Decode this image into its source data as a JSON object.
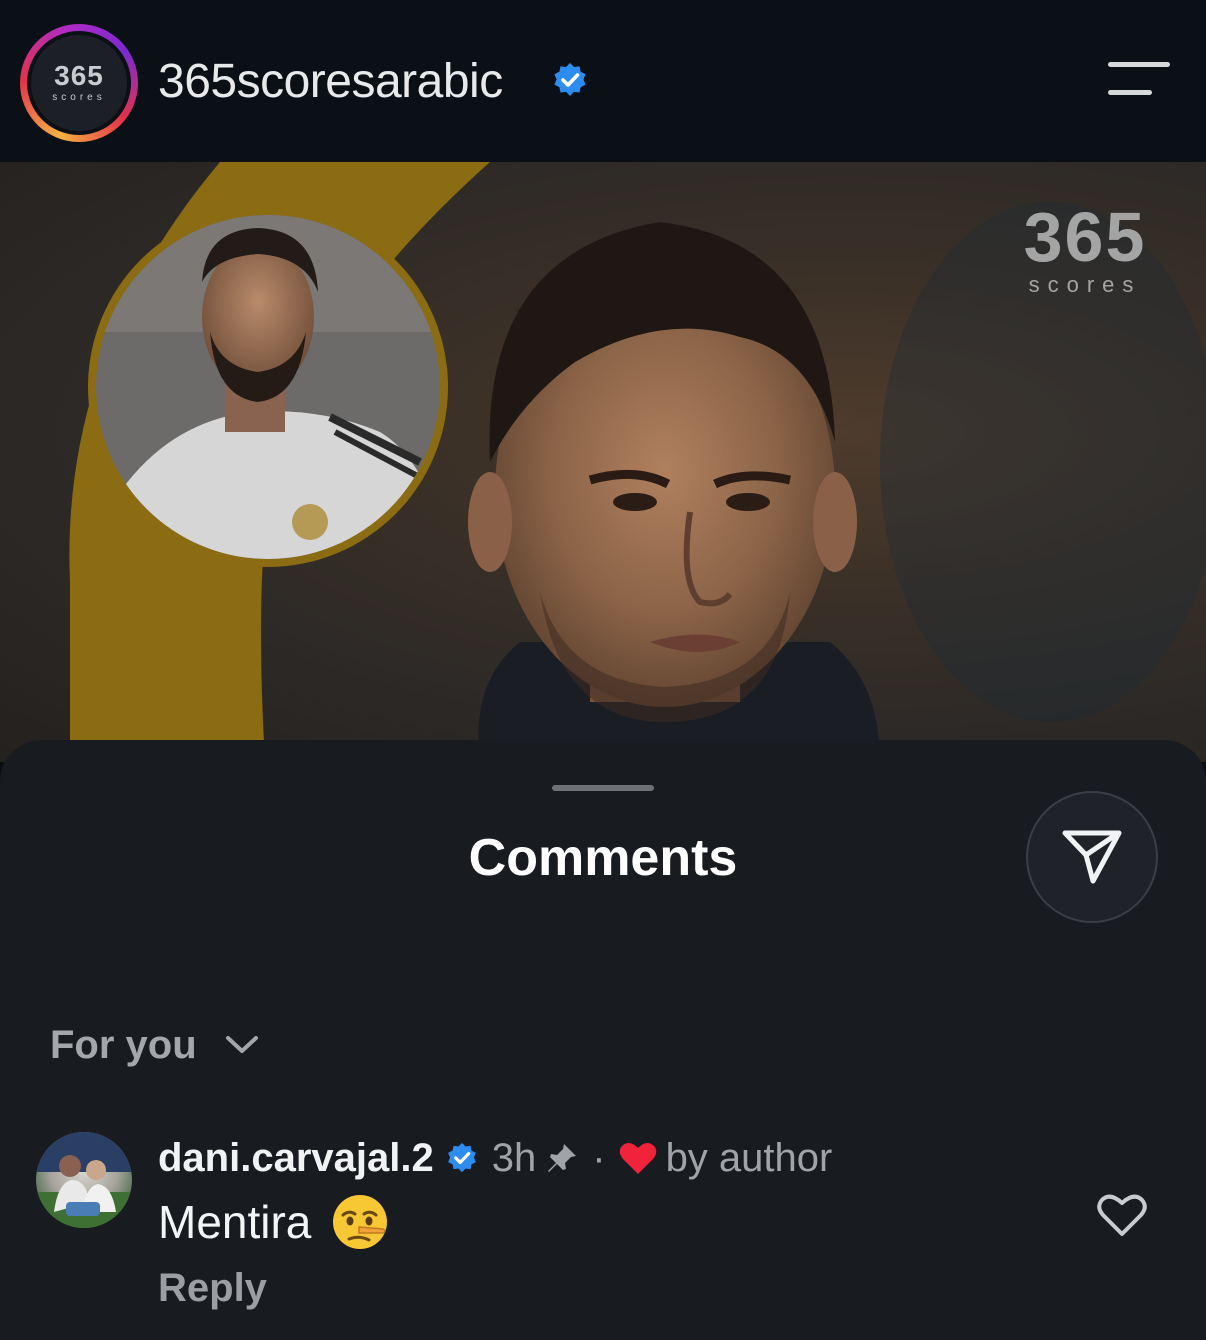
{
  "header": {
    "logo_text": "365",
    "logo_subtext": "scores",
    "account_name": "365scoresarabic"
  },
  "post_image": {
    "watermark_text": "365",
    "watermark_subtext": "scores"
  },
  "comments_sheet": {
    "title": "Comments",
    "sort_label": "For you",
    "comments": [
      {
        "username": "dani.carvajal.2",
        "time": "3h",
        "separator": "·",
        "author_like_label": "by author",
        "text": "Mentira",
        "reply_label": "Reply"
      }
    ]
  },
  "colors": {
    "background": "#0b0f16",
    "sheet": "#181b20",
    "verified_blue": "#2d8cf0",
    "heart_red": "#f0233a",
    "ring_gold": "#c8900f"
  },
  "icons": {
    "menu": "hamburger-icon",
    "share": "send-icon",
    "sort": "chevron-down-icon",
    "verified": "verified-badge-icon",
    "pin": "pin-icon",
    "heart": "heart-icon",
    "like": "heart-outline-icon",
    "emoji": "lying-face-emoji"
  }
}
